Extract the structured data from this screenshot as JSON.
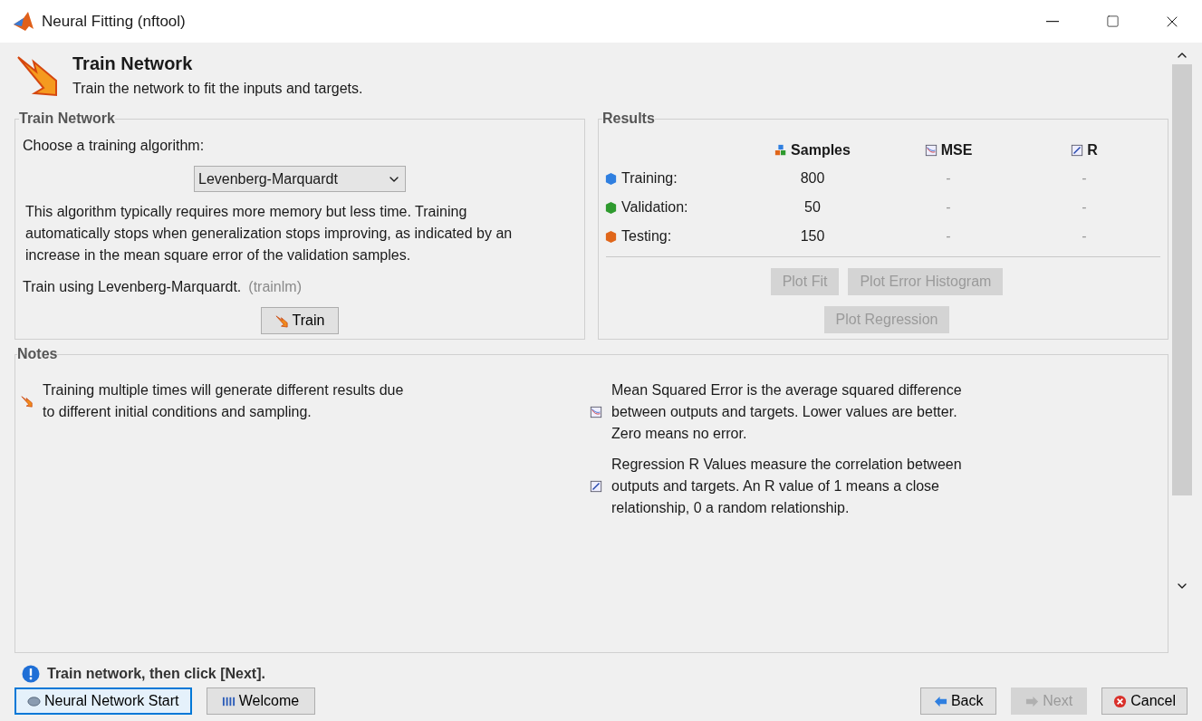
{
  "window": {
    "title": "Neural Fitting (nftool)"
  },
  "header": {
    "title": "Train Network",
    "subtitle": "Train the network to fit the inputs and targets."
  },
  "train_panel": {
    "title": "Train Network",
    "prompt": "Choose a training algorithm:",
    "algorithm": {
      "value": "Levenberg-Marquardt"
    },
    "description": "This algorithm typically requires more memory but less time. Training automatically stops when generalization stops improving, as indicated by an increase in the mean square error of the validation samples.",
    "train_using": "Train using Levenberg-Marquardt.",
    "function_name": "(trainlm)",
    "train_button": {
      "label": "Train",
      "disabled": false
    }
  },
  "results": {
    "title": "Results",
    "columns": [
      {
        "label": "Samples",
        "kind": "samples"
      },
      {
        "label": "MSE",
        "kind": "mse"
      },
      {
        "label": "R",
        "kind": "regression"
      }
    ],
    "rows": [
      {
        "label": "Training:",
        "color": "#2f7fe0",
        "samples": "800",
        "mse": "-",
        "r": "-"
      },
      {
        "label": "Validation:",
        "color": "#2e9a2e",
        "samples": "50",
        "mse": "-",
        "r": "-"
      },
      {
        "label": "Testing:",
        "color": "#e0661a",
        "samples": "150",
        "mse": "-",
        "r": "-"
      }
    ],
    "button_rows": [
      [
        {
          "label": "Plot Fit",
          "disabled": true
        },
        {
          "label": "Plot Error Histogram",
          "disabled": true
        }
      ],
      [
        {
          "label": "Plot Regression",
          "disabled": true
        }
      ]
    ]
  },
  "notes": {
    "title": "Notes",
    "columns": [
      [
        {
          "kind": "train",
          "text": "Training multiple times will generate different results due to different initial conditions and sampling."
        }
      ],
      [
        {
          "kind": "mse",
          "text": "Mean Squared Error is the average squared difference between outputs and targets. Lower values are better. Zero means no error."
        },
        {
          "kind": "regression",
          "text": "Regression R Values measure the correlation between outputs and targets. An R value of 1 means a close relationship, 0 a random relationship."
        }
      ]
    ]
  },
  "status": {
    "text": "Train network, then click [Next]."
  },
  "footer": {
    "left": [
      {
        "label": "Neural Network Start",
        "kind": "start",
        "focused": true,
        "disabled": false
      },
      {
        "label": "Welcome",
        "kind": "welcome",
        "focused": false,
        "disabled": false
      }
    ],
    "right": [
      {
        "label": "Back",
        "kind": "back",
        "focused": false,
        "disabled": false
      },
      {
        "label": "Next",
        "kind": "next",
        "focused": false,
        "disabled": true
      },
      {
        "label": "Cancel",
        "kind": "cancel",
        "focused": false,
        "disabled": false
      }
    ]
  }
}
